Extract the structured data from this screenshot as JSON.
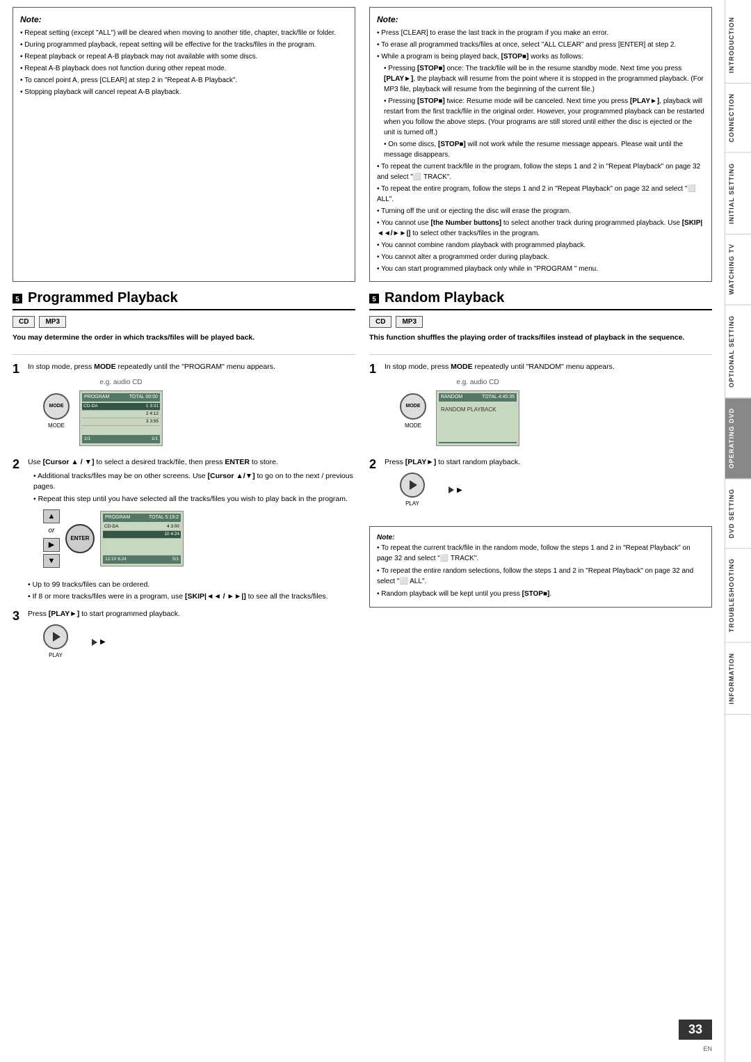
{
  "page": {
    "number": "33",
    "en_label": "EN"
  },
  "sidebar": {
    "sections": [
      {
        "label": "INTRODUCTION",
        "active": false
      },
      {
        "label": "CONNECTION",
        "active": false
      },
      {
        "label": "INITIAL SETTING",
        "active": false
      },
      {
        "label": "WATCHING TV",
        "active": false
      },
      {
        "label": "OPTIONAL SETTING",
        "active": false
      },
      {
        "label": "OPERATING DVD",
        "active": true
      },
      {
        "label": "DVD SETTING",
        "active": false
      },
      {
        "label": "TROUBLESHOOTING",
        "active": false
      },
      {
        "label": "INFORMATION",
        "active": false
      }
    ]
  },
  "top_note_left": {
    "title": "Note:",
    "items": [
      "Repeat setting (except \"ALL\") will be cleared when moving to another title, chapter, track/file or folder.",
      "During programmed playback, repeat setting will be effective for the tracks/files in the program.",
      "Repeat playback or repeat A-B playback may not available with some discs.",
      "Repeat A-B playback does not function during other repeat mode.",
      "To cancel point A, press [CLEAR] at step 2 in \"Repeat A-B Playback\".",
      "Stopping playback will cancel repeat A-B playback."
    ]
  },
  "top_note_right": {
    "title": "Note:",
    "items": [
      "Press [CLEAR] to erase the last track in the program if you make an error.",
      "To erase all programmed tracks/files at once, select \"ALL CLEAR\" and press [ENTER] at step 2.",
      "While a program is being played back, [STOP■] works as follows:",
      "Pressing [STOP■] once: The track/file will be in the resume standby mode. Next time you press [PLAY►], the playback will resume from the point where it is stopped in the programmed playback. (For MP3 file, playback will resume from the beginning of the current file.)",
      "Pressing [STOP■] twice: Resume mode will be canceled. Next time you press [PLAY►], playback will restart from the first track/file in the original order. However, your programmed playback can be restarted when you follow the above steps. (Your programs are still stored until either the disc is ejected or the unit is turned off.)",
      "On some discs, [STOP■] will not work while the resume message appears. Please wait until the message disappears.",
      "To repeat the current track/file in the program, follow the steps 1 and 2 in \"Repeat Playback\" on page 32 and select \"⬜ TRACK\".",
      "To repeat the entire program, follow the steps 1 and 2 in \"Repeat Playback\" on page 32 and select \"⬜ ALL\".",
      "Turning off the unit or ejecting the disc will erase the program.",
      "You cannot use [the Number buttons] to select another track during programmed playback. Use [SKIP|◄◄/►►|] to select other tracks/files in the program.",
      "You cannot combine random playback with programmed playback.",
      "You cannot alter a programmed order during playback.",
      "You can start programmed playback only while in \"PROGRAM\" menu."
    ]
  },
  "programmed_playback": {
    "title": "Programmed Playback",
    "checkbox": "5",
    "badges": [
      "CD",
      "MP3"
    ],
    "intro": "You may determine the order in which tracks/files will be played back.",
    "steps": [
      {
        "num": "1",
        "text": "In stop mode, press MODE repeatedly until the \"PROGRAM\" menu appears.",
        "eg_label": "e.g. audio CD",
        "btn_label": "MODE"
      },
      {
        "num": "2",
        "text": "Use [Cursor ▲ / ▼] to select a desired track/file, then press ENTER to store.",
        "sub_bullets": [
          "Additional tracks/files may be on other screens. Use [Cursor ▲/▼] to go on to the next / previous pages.",
          "Repeat this step until you have selected all the tracks/files you wish to play back in the program."
        ],
        "or_label": "or"
      },
      {
        "num": "extra_bullets",
        "bullets": [
          "Up to 99 tracks/files can be ordered.",
          "If 8 or more tracks/files were in a program, use [SKIP|◄◄ / ►►|] to see all the tracks/files."
        ]
      },
      {
        "num": "3",
        "text": "Press [PLAY►] to start programmed playback.",
        "btn_label": "PLAY"
      }
    ]
  },
  "random_playback": {
    "title": "Random Playback",
    "checkbox": "5",
    "badges": [
      "CD",
      "MP3"
    ],
    "intro": "This function shuffles the playing order of tracks/files instead of playback in the sequence.",
    "steps": [
      {
        "num": "1",
        "text": "In stop mode, press MODE repeatedly until \"RANDOM\" menu appears.",
        "eg_label": "e.g. audio CD",
        "btn_label": "MODE"
      },
      {
        "num": "2",
        "text": "Press [PLAY►] to start random playback.",
        "btn_label": "PLAY"
      }
    ],
    "note": {
      "title": "Note:",
      "items": [
        "To repeat the current track/file in the random mode, follow the steps 1 and 2 in \"Repeat Playback\" on page 32 and select \"⬜ TRACK\".",
        "To repeat the entire random selections, follow the steps 1 and 2 in \"Repeat Playback\" on page 32 and select \"⬜ ALL\".",
        "Random playback will be kept until you press [STOP■]."
      ]
    }
  }
}
